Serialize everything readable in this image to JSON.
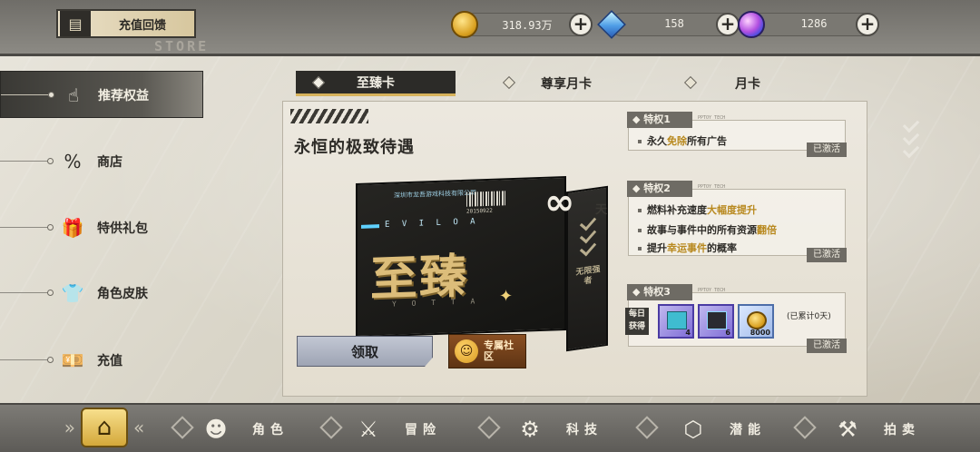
{
  "header": {
    "store_button_label": "充值回馈",
    "store_subtitle": "STORE",
    "currencies": [
      {
        "name": "gold-coin",
        "value": "318.93万"
      },
      {
        "name": "crystal",
        "value": "158"
      },
      {
        "name": "orb",
        "value": "1286"
      }
    ]
  },
  "sidebar": {
    "items": [
      {
        "label": "推荐权益",
        "icon": "thumbs-up-icon",
        "active": true
      },
      {
        "label": "商店",
        "icon": "percent-icon",
        "active": false
      },
      {
        "label": "特供礼包",
        "icon": "gift-icon",
        "active": false
      },
      {
        "label": "角色皮肤",
        "icon": "shirt-icon",
        "active": false
      },
      {
        "label": "充值",
        "icon": "cash-icon",
        "active": false
      }
    ]
  },
  "tabs": [
    {
      "label": "至臻卡",
      "active": true
    },
    {
      "label": "尊享月卡",
      "active": false
    },
    {
      "label": "月卡",
      "active": false
    }
  ],
  "panel": {
    "title": "永恒的极致待遇",
    "card": {
      "company": "深圳市龙吾游戏科技有限公司",
      "date": "20150922",
      "code": "E V I L O A",
      "big_text": "至臻",
      "sub_text": "Y O T T A",
      "infinity": "∞",
      "infinity_unit": "天",
      "side_text": "无限强者"
    },
    "claim_button": "领取",
    "community_button": "专属社区"
  },
  "privileges": [
    {
      "head": "特权1",
      "brand": "PPTOY TECH",
      "lines": [
        {
          "pre": "永久",
          "hl": "免除",
          "post": "所有广告"
        }
      ],
      "status": "已激活"
    },
    {
      "head": "特权2",
      "brand": "PPTOY TECH",
      "lines": [
        {
          "pre": "燃料补充速度",
          "hl": "大幅度提升",
          "post": ""
        },
        {
          "pre": "故事与事件中的所有资源",
          "hl": "翻倍",
          "post": ""
        },
        {
          "pre": "提升",
          "hl": "幸运事件",
          "post": "的概率"
        }
      ],
      "status": "已激活"
    },
    {
      "head": "特权3",
      "brand": "PPTOY TECH",
      "daily_label": "每日获得",
      "rewards": [
        {
          "count": "4"
        },
        {
          "count": "6"
        },
        {
          "count": "8000"
        }
      ],
      "accumulated": "(已累计0天)",
      "status": "已激活"
    }
  ],
  "bottom_nav": [
    {
      "label": "角色",
      "icon": "character-icon"
    },
    {
      "label": "冒险",
      "icon": "swords-icon"
    },
    {
      "label": "科技",
      "icon": "tech-icon"
    },
    {
      "label": "潜能",
      "icon": "cube-icon"
    },
    {
      "label": "拍卖",
      "icon": "gavel-icon"
    }
  ],
  "colors": {
    "accent_gold": "#d7b25b",
    "highlight_text": "#b8891f",
    "active_dark": "#2c2b28"
  }
}
